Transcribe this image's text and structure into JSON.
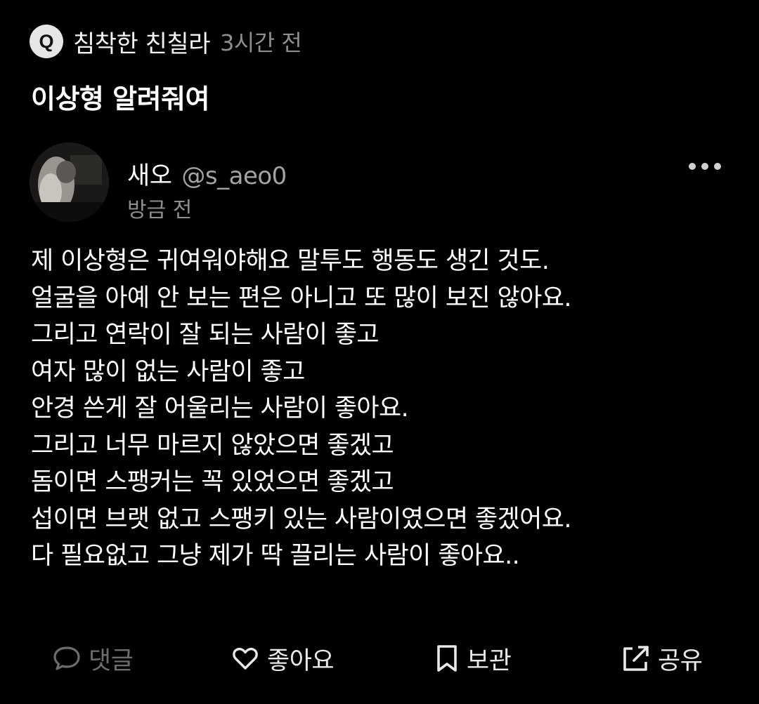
{
  "question": {
    "badge": "Q",
    "author": "침착한 친칠라",
    "time": "3시간 전",
    "title": "이상형 알려줘여"
  },
  "answer": {
    "name": "새오",
    "handle": "@s_aeo0",
    "time": "방금 전",
    "more_icon": "more-horizontal-icon",
    "lines": [
      "제 이상형은 귀여워야해요 말투도 행동도 생긴 것도.",
      "얼굴을 아예 안 보는 편은 아니고 또 많이 보진 않아요.",
      "그리고 연락이 잘 되는 사람이 좋고",
      "여자 많이 없는 사람이 좋고",
      "안경 쓴게 잘 어울리는 사람이 좋아요.",
      "그리고 너무 마르지 않았으면 좋겠고",
      "돔이면 스팽커는 꼭 있었으면 좋겠고",
      "섭이면 브랫 없고 스팽키 있는 사람이였으면 좋겠어요.",
      "다 필요없고 그냥 제가 딱 끌리는 사람이 좋아요.."
    ]
  },
  "actions": {
    "comment": {
      "label": "댓글",
      "icon": "comment-icon"
    },
    "like": {
      "label": "좋아요",
      "icon": "heart-icon"
    },
    "save": {
      "label": "보관",
      "icon": "bookmark-icon"
    },
    "share": {
      "label": "공유",
      "icon": "share-icon"
    }
  },
  "colors": {
    "background": "#000000",
    "text": "#ffffff",
    "muted": "#8e8e8e",
    "disabled": "#6c6c6c"
  }
}
